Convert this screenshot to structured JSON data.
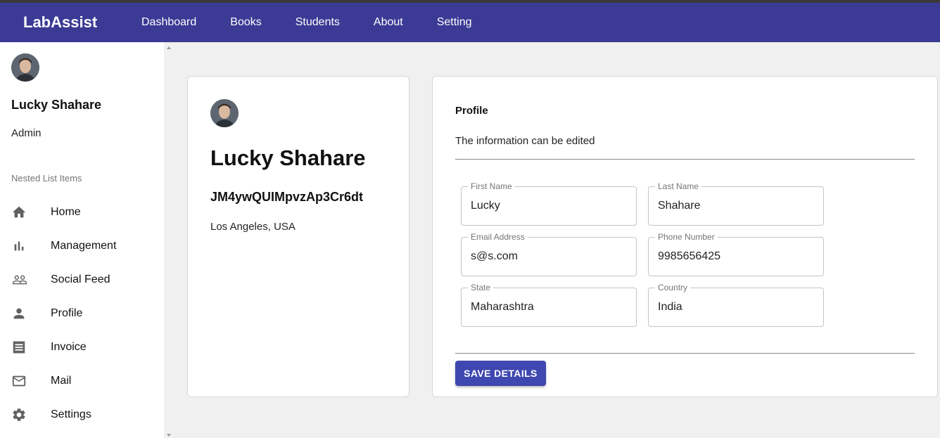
{
  "app": {
    "brand": "LabAssist"
  },
  "nav": {
    "items": [
      {
        "label": "Dashboard"
      },
      {
        "label": "Books"
      },
      {
        "label": "Students"
      },
      {
        "label": "About"
      },
      {
        "label": "Setting"
      }
    ]
  },
  "sidebar": {
    "user_name": "Lucky Shahare",
    "user_role": "Admin",
    "section_label": "Nested List Items",
    "items": [
      {
        "label": "Home",
        "icon": "home-icon"
      },
      {
        "label": "Management",
        "icon": "bar-chart-icon"
      },
      {
        "label": "Social Feed",
        "icon": "people-icon"
      },
      {
        "label": "Profile",
        "icon": "person-icon"
      },
      {
        "label": "Invoice",
        "icon": "receipt-icon"
      },
      {
        "label": "Mail",
        "icon": "mail-icon"
      },
      {
        "label": "Settings",
        "icon": "gear-icon"
      }
    ]
  },
  "profile_card": {
    "name": "Lucky Shahare",
    "id": "JM4ywQUIMpvzAp3Cr6dt",
    "location": "Los Angeles, USA"
  },
  "form": {
    "title": "Profile",
    "subtitle": "The information can be edited",
    "fields": {
      "first_name": {
        "label": "First Name",
        "value": "Lucky"
      },
      "last_name": {
        "label": "Last Name",
        "value": "Shahare"
      },
      "email": {
        "label": "Email Address",
        "value": "s@s.com"
      },
      "phone": {
        "label": "Phone Number",
        "value": "9985656425"
      },
      "state": {
        "label": "State",
        "value": "Maharashtra"
      },
      "country": {
        "label": "Country",
        "value": "India"
      }
    },
    "save_label": "SAVE DETAILS"
  },
  "colors": {
    "navbar": "#3b3a95",
    "button": "#3f48b0"
  }
}
